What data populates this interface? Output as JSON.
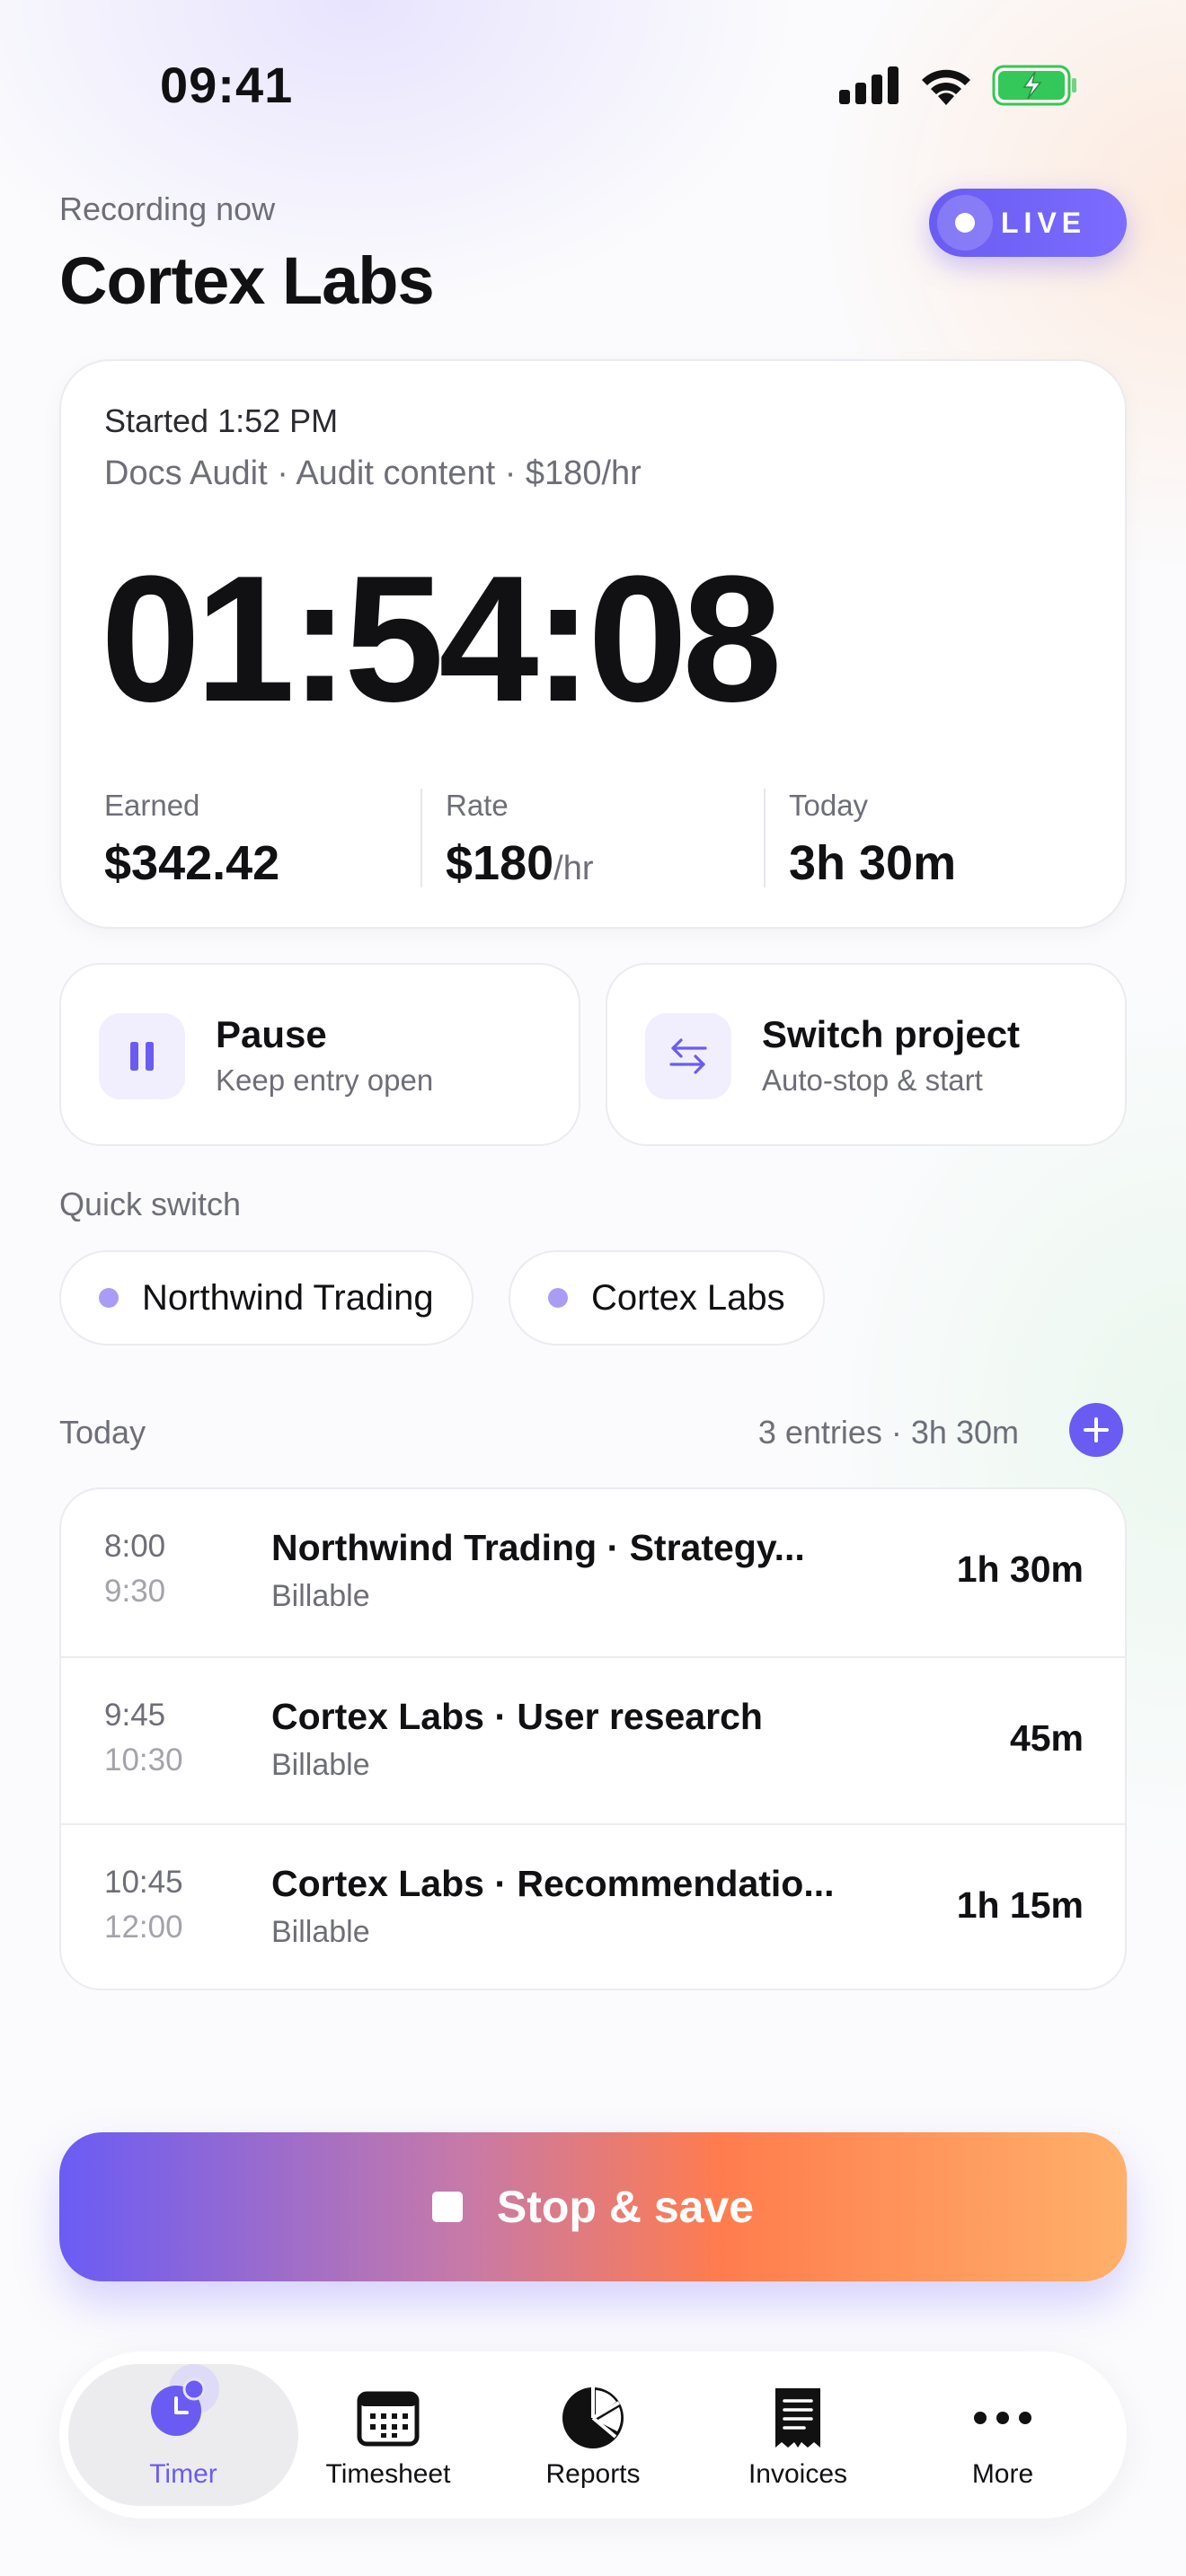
{
  "status_bar": {
    "time": "09:41"
  },
  "header": {
    "eyebrow": "Recording now",
    "title": "Cortex Labs",
    "live_label": "LIVE"
  },
  "timer_card": {
    "started": "Started 1:52 PM",
    "meta": "Docs Audit · Audit content · $180/hr",
    "elapsed": "01:54:08",
    "stats": {
      "earned_label": "Earned",
      "earned_value": "$342.42",
      "rate_label": "Rate",
      "rate_value": "$180",
      "rate_unit": "/hr",
      "today_label": "Today",
      "today_value": "3h 30m"
    }
  },
  "actions": {
    "pause_title": "Pause",
    "pause_sub": "Keep entry open",
    "switch_title": "Switch project",
    "switch_sub": "Auto-stop & start"
  },
  "quick_switch": {
    "label": "Quick switch",
    "chips": [
      "Northwind Trading",
      "Cortex Labs"
    ]
  },
  "today": {
    "label": "Today",
    "summary": "3 entries · 3h 30m",
    "entries": [
      {
        "start": "8:00",
        "end": "9:30",
        "title": "Northwind Trading · Strategy...",
        "tag": "Billable",
        "duration": "1h 30m"
      },
      {
        "start": "9:45",
        "end": "10:30",
        "title": "Cortex Labs · User research",
        "tag": "Billable",
        "duration": "45m"
      },
      {
        "start": "10:45",
        "end": "12:00",
        "title": "Cortex Labs · Recommendatio...",
        "tag": "Billable",
        "duration": "1h 15m"
      }
    ]
  },
  "stop_button": {
    "label": "Stop & save"
  },
  "tabs": [
    {
      "label": "Timer",
      "icon": "clock-icon",
      "active": true
    },
    {
      "label": "Timesheet",
      "icon": "calendar-icon"
    },
    {
      "label": "Reports",
      "icon": "pie-chart-icon"
    },
    {
      "label": "Invoices",
      "icon": "receipt-icon"
    },
    {
      "label": "More",
      "icon": "more-icon"
    }
  ],
  "colors": {
    "accent": "#6a5cf2",
    "chip_dot": "#a99cf5",
    "battery_green": "#34c759",
    "gradient_start": "#6a5cf5",
    "gradient_mid": "#ff7c4e",
    "gradient_end": "#ffb06a"
  }
}
